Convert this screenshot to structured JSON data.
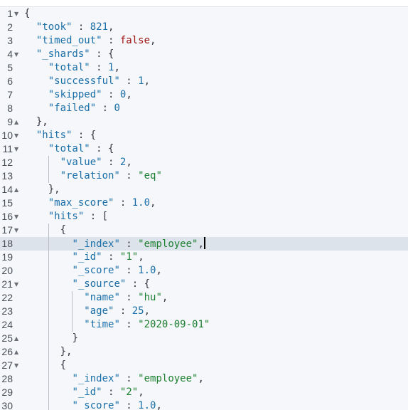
{
  "editor": {
    "active_line": 18,
    "colors": {
      "key": "#1a6fa8",
      "number": "#1a6fa8",
      "string": "#1d8031",
      "boolean": "#a01313",
      "active_line": "#dde3eb",
      "background": "#f5f7fa"
    },
    "lines": [
      {
        "n": "1",
        "fold": "open",
        "indent": 0,
        "t": [
          [
            "p",
            "{"
          ]
        ]
      },
      {
        "n": "2",
        "indent": 2,
        "t": [
          [
            "k",
            "\"took\""
          ],
          [
            "p",
            " : "
          ],
          [
            "n",
            "821"
          ],
          [
            "p",
            ","
          ]
        ]
      },
      {
        "n": "3",
        "indent": 2,
        "t": [
          [
            "k",
            "\"timed_out\""
          ],
          [
            "p",
            " : "
          ],
          [
            "b",
            "false"
          ],
          [
            "p",
            ","
          ]
        ]
      },
      {
        "n": "4",
        "fold": "open",
        "indent": 2,
        "t": [
          [
            "k",
            "\"_shards\""
          ],
          [
            "p",
            " : {"
          ]
        ]
      },
      {
        "n": "5",
        "indent": 4,
        "t": [
          [
            "k",
            "\"total\""
          ],
          [
            "p",
            " : "
          ],
          [
            "n",
            "1"
          ],
          [
            "p",
            ","
          ]
        ]
      },
      {
        "n": "6",
        "indent": 4,
        "t": [
          [
            "k",
            "\"successful\""
          ],
          [
            "p",
            " : "
          ],
          [
            "n",
            "1"
          ],
          [
            "p",
            ","
          ]
        ]
      },
      {
        "n": "7",
        "indent": 4,
        "t": [
          [
            "k",
            "\"skipped\""
          ],
          [
            "p",
            " : "
          ],
          [
            "n",
            "0"
          ],
          [
            "p",
            ","
          ]
        ]
      },
      {
        "n": "8",
        "indent": 4,
        "t": [
          [
            "k",
            "\"failed\""
          ],
          [
            "p",
            " : "
          ],
          [
            "n",
            "0"
          ]
        ]
      },
      {
        "n": "9",
        "fold": "close",
        "indent": 2,
        "t": [
          [
            "p",
            "},"
          ]
        ]
      },
      {
        "n": "10",
        "fold": "open",
        "indent": 2,
        "t": [
          [
            "k",
            "\"hits\""
          ],
          [
            "p",
            " : {"
          ]
        ]
      },
      {
        "n": "11",
        "fold": "open",
        "indent": 4,
        "t": [
          [
            "k",
            "\"total\""
          ],
          [
            "p",
            " : {"
          ]
        ]
      },
      {
        "n": "12",
        "indent": 6,
        "t": [
          [
            "k",
            "\"value\""
          ],
          [
            "p",
            " : "
          ],
          [
            "n",
            "2"
          ],
          [
            "p",
            ","
          ]
        ]
      },
      {
        "n": "13",
        "indent": 6,
        "t": [
          [
            "k",
            "\"relation\""
          ],
          [
            "p",
            " : "
          ],
          [
            "s",
            "\"eq\""
          ]
        ]
      },
      {
        "n": "14",
        "fold": "close",
        "indent": 4,
        "t": [
          [
            "p",
            "},"
          ]
        ]
      },
      {
        "n": "15",
        "indent": 4,
        "t": [
          [
            "k",
            "\"max_score\""
          ],
          [
            "p",
            " : "
          ],
          [
            "n",
            "1.0"
          ],
          [
            "p",
            ","
          ]
        ]
      },
      {
        "n": "16",
        "fold": "open",
        "indent": 4,
        "t": [
          [
            "k",
            "\"hits\""
          ],
          [
            "p",
            " : ["
          ]
        ]
      },
      {
        "n": "17",
        "fold": "open",
        "indent": 6,
        "t": [
          [
            "p",
            "{"
          ]
        ]
      },
      {
        "n": "18",
        "indent": 8,
        "t": [
          [
            "k",
            "\"_index\""
          ],
          [
            "p",
            " : "
          ],
          [
            "s",
            "\"employee\""
          ],
          [
            "p",
            ","
          ]
        ]
      },
      {
        "n": "19",
        "indent": 8,
        "t": [
          [
            "k",
            "\"_id\""
          ],
          [
            "p",
            " : "
          ],
          [
            "s",
            "\"1\""
          ],
          [
            "p",
            ","
          ]
        ]
      },
      {
        "n": "20",
        "indent": 8,
        "t": [
          [
            "k",
            "\"_score\""
          ],
          [
            "p",
            " : "
          ],
          [
            "n",
            "1.0"
          ],
          [
            "p",
            ","
          ]
        ]
      },
      {
        "n": "21",
        "fold": "open",
        "indent": 8,
        "t": [
          [
            "k",
            "\"_source\""
          ],
          [
            "p",
            " : {"
          ]
        ]
      },
      {
        "n": "22",
        "indent": 10,
        "t": [
          [
            "k",
            "\"name\""
          ],
          [
            "p",
            " : "
          ],
          [
            "s",
            "\"hu\""
          ],
          [
            "p",
            ","
          ]
        ]
      },
      {
        "n": "23",
        "indent": 10,
        "t": [
          [
            "k",
            "\"age\""
          ],
          [
            "p",
            " : "
          ],
          [
            "n",
            "25"
          ],
          [
            "p",
            ","
          ]
        ]
      },
      {
        "n": "24",
        "indent": 10,
        "t": [
          [
            "k",
            "\"time\""
          ],
          [
            "p",
            " : "
          ],
          [
            "s",
            "\"2020-09-01\""
          ]
        ]
      },
      {
        "n": "25",
        "fold": "close",
        "indent": 8,
        "t": [
          [
            "p",
            "}"
          ]
        ]
      },
      {
        "n": "26",
        "fold": "close",
        "indent": 6,
        "t": [
          [
            "p",
            "},"
          ]
        ]
      },
      {
        "n": "27",
        "fold": "open",
        "indent": 6,
        "t": [
          [
            "p",
            "{"
          ]
        ]
      },
      {
        "n": "28",
        "indent": 8,
        "t": [
          [
            "k",
            "\"_index\""
          ],
          [
            "p",
            " : "
          ],
          [
            "s",
            "\"employee\""
          ],
          [
            "p",
            ","
          ]
        ]
      },
      {
        "n": "29",
        "indent": 8,
        "t": [
          [
            "k",
            "\"_id\""
          ],
          [
            "p",
            " : "
          ],
          [
            "s",
            "\"2\""
          ],
          [
            "p",
            ","
          ]
        ]
      },
      {
        "n": "30",
        "indent": 8,
        "t": [
          [
            "k",
            "\"_score\""
          ],
          [
            "p",
            " : "
          ],
          [
            "n",
            "1.0"
          ],
          [
            "p",
            ","
          ]
        ]
      }
    ]
  }
}
